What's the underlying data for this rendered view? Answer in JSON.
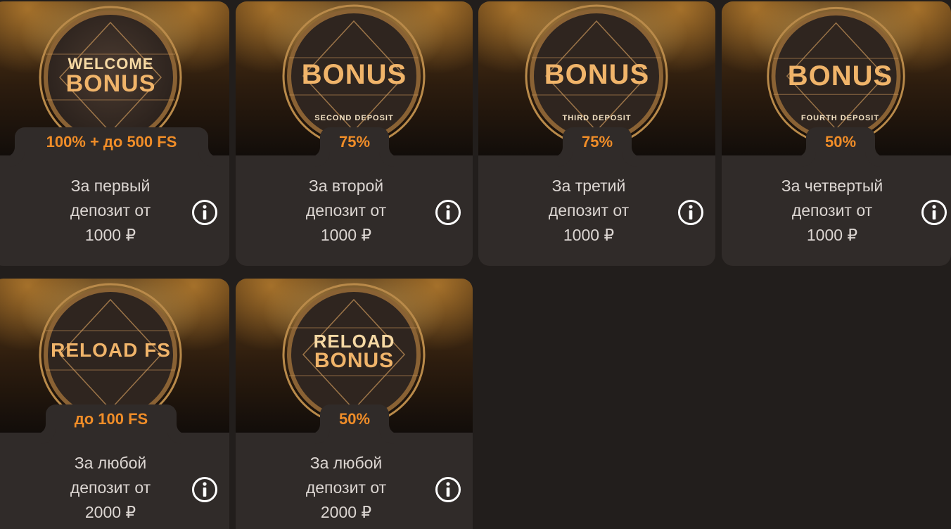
{
  "cards": [
    {
      "badge_line1": "WELCOME",
      "badge_line2": "BONUS",
      "badge_sub": "",
      "amount": "100% + до 500 FS",
      "desc1": "За первый",
      "desc2": "депозит от",
      "desc3": "1000 ₽"
    },
    {
      "badge_line1": "",
      "badge_line2": "BONUS",
      "badge_sub": "SECOND DEPOSIT",
      "amount": "75%",
      "desc1": "За второй",
      "desc2": "депозит от",
      "desc3": "1000 ₽"
    },
    {
      "badge_line1": "",
      "badge_line2": "BONUS",
      "badge_sub": "THIRD DEPOSIT",
      "amount": "75%",
      "desc1": "За третий",
      "desc2": "депозит от",
      "desc3": "1000 ₽"
    },
    {
      "badge_line1": "",
      "badge_line2": "BONUS",
      "badge_sub": "FOURTH DEPOSIT",
      "amount": "50%",
      "desc1": "За четвертый",
      "desc2": "депозит от",
      "desc3": "1000 ₽"
    },
    {
      "badge_line1": "",
      "badge_line2": "RELOAD FS",
      "badge_sub": "",
      "amount": "до 100 FS",
      "desc1": "За любой",
      "desc2": "депозит от",
      "desc3": "2000 ₽"
    },
    {
      "badge_line1": "RELOAD",
      "badge_line2": "BONUS",
      "badge_sub": "",
      "amount": "50%",
      "desc1": "За любой",
      "desc2": "депозит от",
      "desc3": "2000 ₽"
    }
  ],
  "colors": {
    "accent": "#f08d28",
    "card_bg": "#302b29",
    "page_bg": "#221e1c",
    "gold": "#e9b06a"
  },
  "icons": {
    "info": "info-icon"
  }
}
